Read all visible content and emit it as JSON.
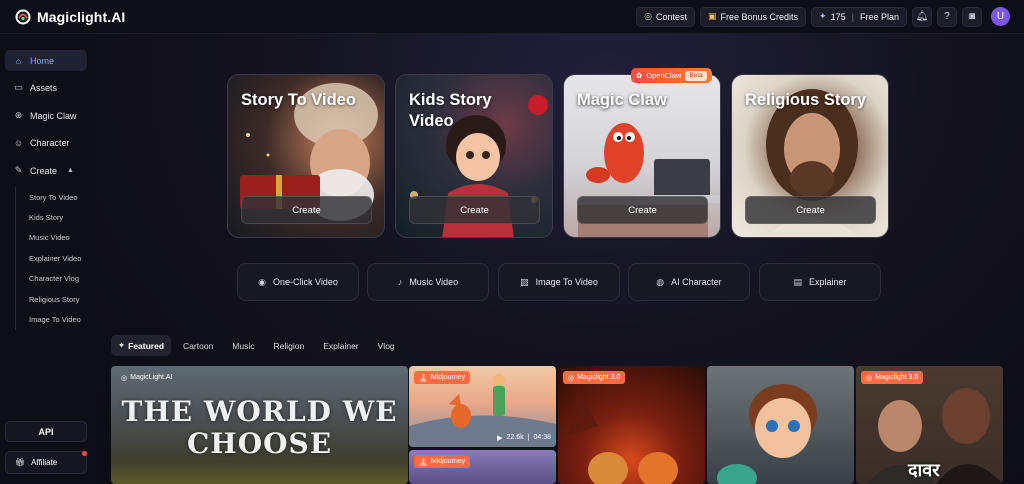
{
  "brand": {
    "name": "Magiclight.AI"
  },
  "header": {
    "contest_label": "Contest",
    "bonus_label": "Free Bonus Credits",
    "credits": "175",
    "plan": "Free Plan",
    "avatar_initial": "U"
  },
  "sidebar": {
    "items": [
      {
        "label": "Home",
        "icon": "home-icon"
      },
      {
        "label": "Assets",
        "icon": "folder-icon"
      },
      {
        "label": "Magic Claw",
        "icon": "claw-icon"
      },
      {
        "label": "Character",
        "icon": "character-icon"
      },
      {
        "label": "Create",
        "icon": "create-icon"
      }
    ],
    "sub_items": [
      "Story To Video",
      "Kids Story",
      "Music Video",
      "Explainer Video",
      "Character Vlog",
      "Religious Story",
      "Image To Video"
    ],
    "api_label": "API",
    "affiliate_label": "Affiliate"
  },
  "feature_cards": [
    {
      "title": "Story To Video",
      "button": "Create"
    },
    {
      "title": "Kids Story Video",
      "button": "Create"
    },
    {
      "title": "Magic Claw",
      "button": "Create"
    },
    {
      "title": "Religious Story",
      "button": "Create"
    }
  ],
  "openclaw_badge": {
    "label": "OpenClaw",
    "beta": "Beta"
  },
  "quick_actions": [
    "One-Click Video",
    "Music Video",
    "Image To Video",
    "AI Character",
    "Explainer"
  ],
  "tabs": [
    "Featured",
    "Cartoon",
    "Music",
    "Religion",
    "Explainer",
    "Vlog"
  ],
  "gallery": {
    "item1_badge": "MagicLight.AI",
    "item1_text": "THE WORLD WE CHOOSE",
    "item2_badge": "Midjourney",
    "item2_views": "22.6k",
    "item2_duration": "04:38",
    "item3_badge": "Midjourney",
    "item4_badge": "Magiclight 3.0",
    "item6_badge": "Magiclight 3.0",
    "item6_caption": "दावर"
  },
  "colors": {
    "accent": "#79a6ff",
    "badge_orange": "#ff6a43",
    "avatar": "#7b56e0"
  }
}
